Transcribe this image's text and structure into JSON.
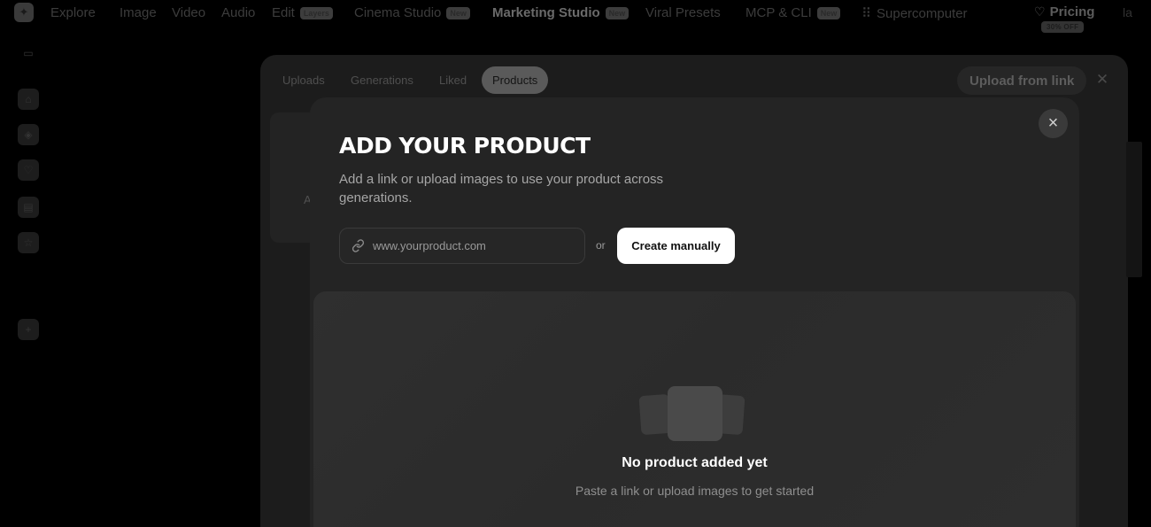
{
  "nav": {
    "logo_icon": "logo-icon",
    "items": [
      {
        "label": "Explore"
      },
      {
        "label": "Image"
      },
      {
        "label": "Video"
      },
      {
        "label": "Audio"
      },
      {
        "label": "Edit",
        "badge": "Layers"
      },
      {
        "label": "Cinema Studio",
        "badge": "New"
      },
      {
        "label": "Marketing Studio",
        "badge": "New"
      },
      {
        "label": "Viral Presets"
      },
      {
        "label": "MCP & CLI",
        "badge": "New"
      },
      {
        "label": "Supercomputer"
      }
    ],
    "pricing_label": "Pricing",
    "discount_label": "30% OFF",
    "edge_text": "la"
  },
  "sidebar": {
    "icons": [
      "monitor-icon",
      "home-icon",
      "compass-icon",
      "heart-icon",
      "folder-icon",
      "star-icon",
      "plus-icon"
    ]
  },
  "panel": {
    "tabs": [
      "Uploads",
      "Generations",
      "Liked",
      "Products"
    ],
    "active_tab": "Products",
    "upload_from_link_label": "Upload from link",
    "card_letter": "A"
  },
  "modal": {
    "title": "ADD YOUR PRODUCT",
    "subtitle": "Add a link or upload images to use your product across generations.",
    "url_placeholder": "www.yourproduct.com",
    "or_label": "or",
    "create_button_label": "Create manually",
    "empty_title": "No product added yet",
    "empty_subtitle": "Paste a link or upload images to get started"
  }
}
